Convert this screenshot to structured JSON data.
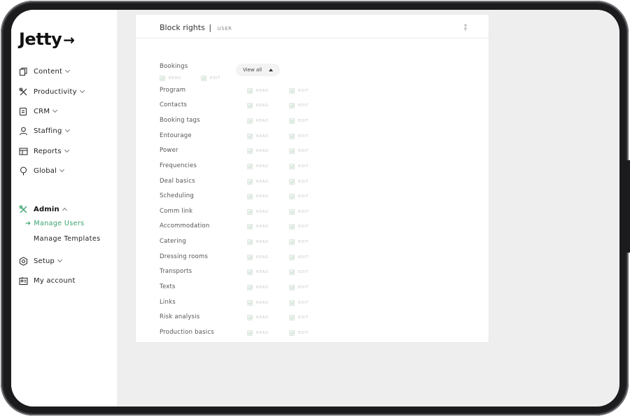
{
  "sidebar": {
    "logo": "Jetty",
    "logo_arrow": "→",
    "items": [
      {
        "label": "Content",
        "icon": "copy-icon"
      },
      {
        "label": "Productivity",
        "icon": "tools-icon"
      },
      {
        "label": "CRM",
        "icon": "scroll-icon"
      },
      {
        "label": "Staffing",
        "icon": "person-icon"
      },
      {
        "label": "Reports",
        "icon": "chart-icon"
      },
      {
        "label": "Global",
        "icon": "globe-pin-icon"
      }
    ],
    "admin": {
      "label": "Admin",
      "icon": "admin-tools-icon"
    },
    "admin_sub": [
      {
        "label": "Manage Users",
        "active": true
      },
      {
        "label": "Manage Templates",
        "active": false
      }
    ],
    "setup": {
      "label": "Setup",
      "icon": "gear-icon"
    },
    "account": {
      "label": "My account",
      "icon": "id-card-icon"
    }
  },
  "card": {
    "title": "Block rights",
    "separator": "|",
    "subtitle": "USER",
    "view_all": "View all",
    "read_label": "READ",
    "edit_label": "EDIT",
    "rows": [
      "Bookings",
      "Program",
      "Contacts",
      "Booking tags",
      "Entourage",
      "Power",
      "Frequencies",
      "Deal basics",
      "Scheduling",
      "Comm link",
      "Accommodation",
      "Catering",
      "Dressing rooms",
      "Transports",
      "Texts",
      "Links",
      "Risk analysis",
      "Production basics"
    ]
  },
  "colors": {
    "accent": "#39a36b",
    "screen_bg": "#eeeeee",
    "device": "#1b1b1d"
  }
}
